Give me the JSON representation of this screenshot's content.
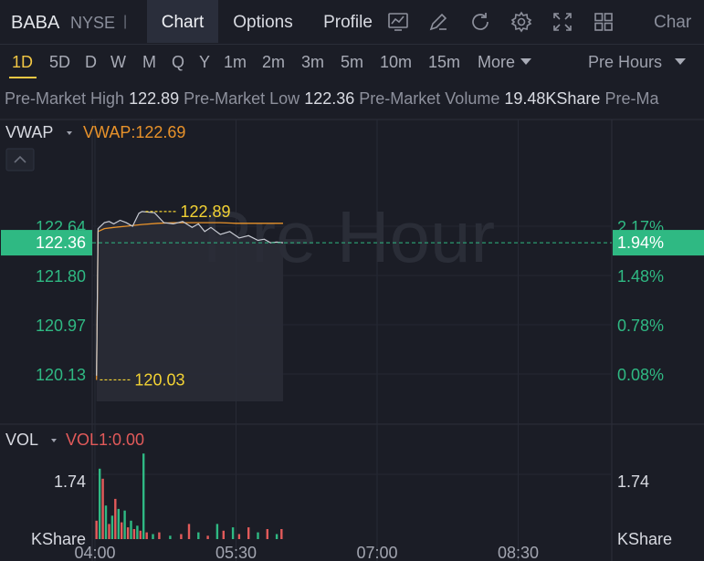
{
  "header": {
    "symbol": "BABA",
    "exchange": "NYSE",
    "separator": "|",
    "tabs": [
      {
        "label": "Chart",
        "active": true
      },
      {
        "label": "Options",
        "active": false
      },
      {
        "label": "Profile",
        "active": false
      }
    ],
    "icons": [
      "chart-settings-icon",
      "draw-icon",
      "refresh-icon",
      "gear-icon",
      "fullscreen-icon",
      "layout-grid-icon"
    ],
    "truncated_label": "Char"
  },
  "periods": {
    "items": [
      "1D",
      "5D",
      "D",
      "W",
      "M",
      "Q",
      "Y",
      "1m",
      "2m",
      "3m",
      "5m",
      "10m",
      "15m",
      "More"
    ],
    "active": "1D",
    "session_select": "Pre Hours"
  },
  "info": {
    "high_label": "Pre-Market High",
    "high_value": "122.89",
    "low_label": "Pre-Market Low",
    "low_value": "122.36",
    "volume_label": "Pre-Market Volume",
    "volume_value": "19.48KShare",
    "trailing": "Pre-Ma"
  },
  "indicators": {
    "price_indicator": "VWAP",
    "price_indicator_value": "VWAP:122.69",
    "volume_indicator": "VOL",
    "volume_indicator_value": "VOL1:0.00"
  },
  "watermark": "Pre Hour",
  "colors": {
    "background": "#1b1d26",
    "up": "#2fb983",
    "down": "#e25a5a",
    "vwap_line": "#e8922a",
    "annotation": "#f2d234",
    "accent": "#f2c744"
  },
  "chart_data": {
    "type": "line",
    "price_axis_labels": [
      "122.64",
      "121.80",
      "120.97",
      "120.13"
    ],
    "percent_axis_labels": [
      "2.17%",
      "1.48%",
      "0.78%",
      "0.08%"
    ],
    "current_price": "122.36",
    "current_percent": "1.94%",
    "x_tick_labels": [
      "04:00",
      "05:30",
      "07:00",
      "08:30"
    ],
    "ylim": [
      119.5,
      123.2
    ],
    "xlim_minutes": [
      0,
      345
    ],
    "high_marker": {
      "label": "122.89",
      "value": 122.89,
      "time_min": 30
    },
    "low_marker": {
      "label": "120.03",
      "value": 120.03,
      "time_min": 2
    },
    "price_series": {
      "name": "price",
      "t": [
        1,
        2,
        6,
        9,
        12,
        16,
        20,
        24,
        28,
        30,
        38,
        44,
        50,
        56,
        62,
        66,
        70,
        74,
        80,
        86,
        92,
        98,
        104,
        108,
        112,
        116,
        120
      ],
      "v": [
        120.1,
        122.6,
        122.7,
        122.72,
        122.68,
        122.74,
        122.7,
        122.64,
        122.86,
        122.89,
        122.87,
        122.7,
        122.68,
        122.72,
        122.62,
        122.68,
        122.55,
        122.62,
        122.5,
        122.55,
        122.44,
        122.48,
        122.4,
        122.42,
        122.36,
        122.37,
        122.36
      ]
    },
    "vwap_series": {
      "name": "VWAP",
      "t": [
        1,
        2,
        6,
        12,
        20,
        30,
        40,
        50,
        60,
        70,
        80,
        90,
        100,
        110,
        120
      ],
      "v": [
        120.03,
        122.55,
        122.6,
        122.62,
        122.64,
        122.67,
        122.69,
        122.7,
        122.7,
        122.7,
        122.7,
        122.69,
        122.69,
        122.69,
        122.69
      ]
    },
    "volume_axis_label": "1.74",
    "volume_unit_label": "KShare",
    "volume_max": 2.6,
    "volume_bars": [
      {
        "t": 1,
        "v": 0.55,
        "up": false
      },
      {
        "t": 3,
        "v": 2.1,
        "up": true
      },
      {
        "t": 5,
        "v": 1.8,
        "up": false
      },
      {
        "t": 7,
        "v": 1.0,
        "up": true
      },
      {
        "t": 9,
        "v": 0.45,
        "up": false
      },
      {
        "t": 11,
        "v": 0.7,
        "up": true
      },
      {
        "t": 13,
        "v": 1.2,
        "up": false
      },
      {
        "t": 15,
        "v": 0.9,
        "up": true
      },
      {
        "t": 17,
        "v": 0.5,
        "up": false
      },
      {
        "t": 19,
        "v": 0.85,
        "up": true
      },
      {
        "t": 21,
        "v": 0.35,
        "up": false
      },
      {
        "t": 23,
        "v": 0.55,
        "up": true
      },
      {
        "t": 25,
        "v": 0.3,
        "up": false
      },
      {
        "t": 27,
        "v": 0.4,
        "up": true
      },
      {
        "t": 29,
        "v": 0.25,
        "up": false
      },
      {
        "t": 31,
        "v": 2.55,
        "up": true
      },
      {
        "t": 33,
        "v": 0.2,
        "up": false
      },
      {
        "t": 37,
        "v": 0.15,
        "up": true
      },
      {
        "t": 41,
        "v": 0.2,
        "up": false
      },
      {
        "t": 48,
        "v": 0.1,
        "up": true
      },
      {
        "t": 55,
        "v": 0.15,
        "up": false
      },
      {
        "t": 60,
        "v": 0.45,
        "up": false
      },
      {
        "t": 66,
        "v": 0.2,
        "up": true
      },
      {
        "t": 72,
        "v": 0.1,
        "up": false
      },
      {
        "t": 78,
        "v": 0.45,
        "up": true
      },
      {
        "t": 82,
        "v": 0.25,
        "up": false
      },
      {
        "t": 88,
        "v": 0.35,
        "up": true
      },
      {
        "t": 92,
        "v": 0.15,
        "up": false
      },
      {
        "t": 98,
        "v": 0.35,
        "up": false
      },
      {
        "t": 104,
        "v": 0.2,
        "up": true
      },
      {
        "t": 110,
        "v": 0.3,
        "up": false
      },
      {
        "t": 116,
        "v": 0.15,
        "up": true
      },
      {
        "t": 119,
        "v": 0.3,
        "up": false
      }
    ]
  }
}
